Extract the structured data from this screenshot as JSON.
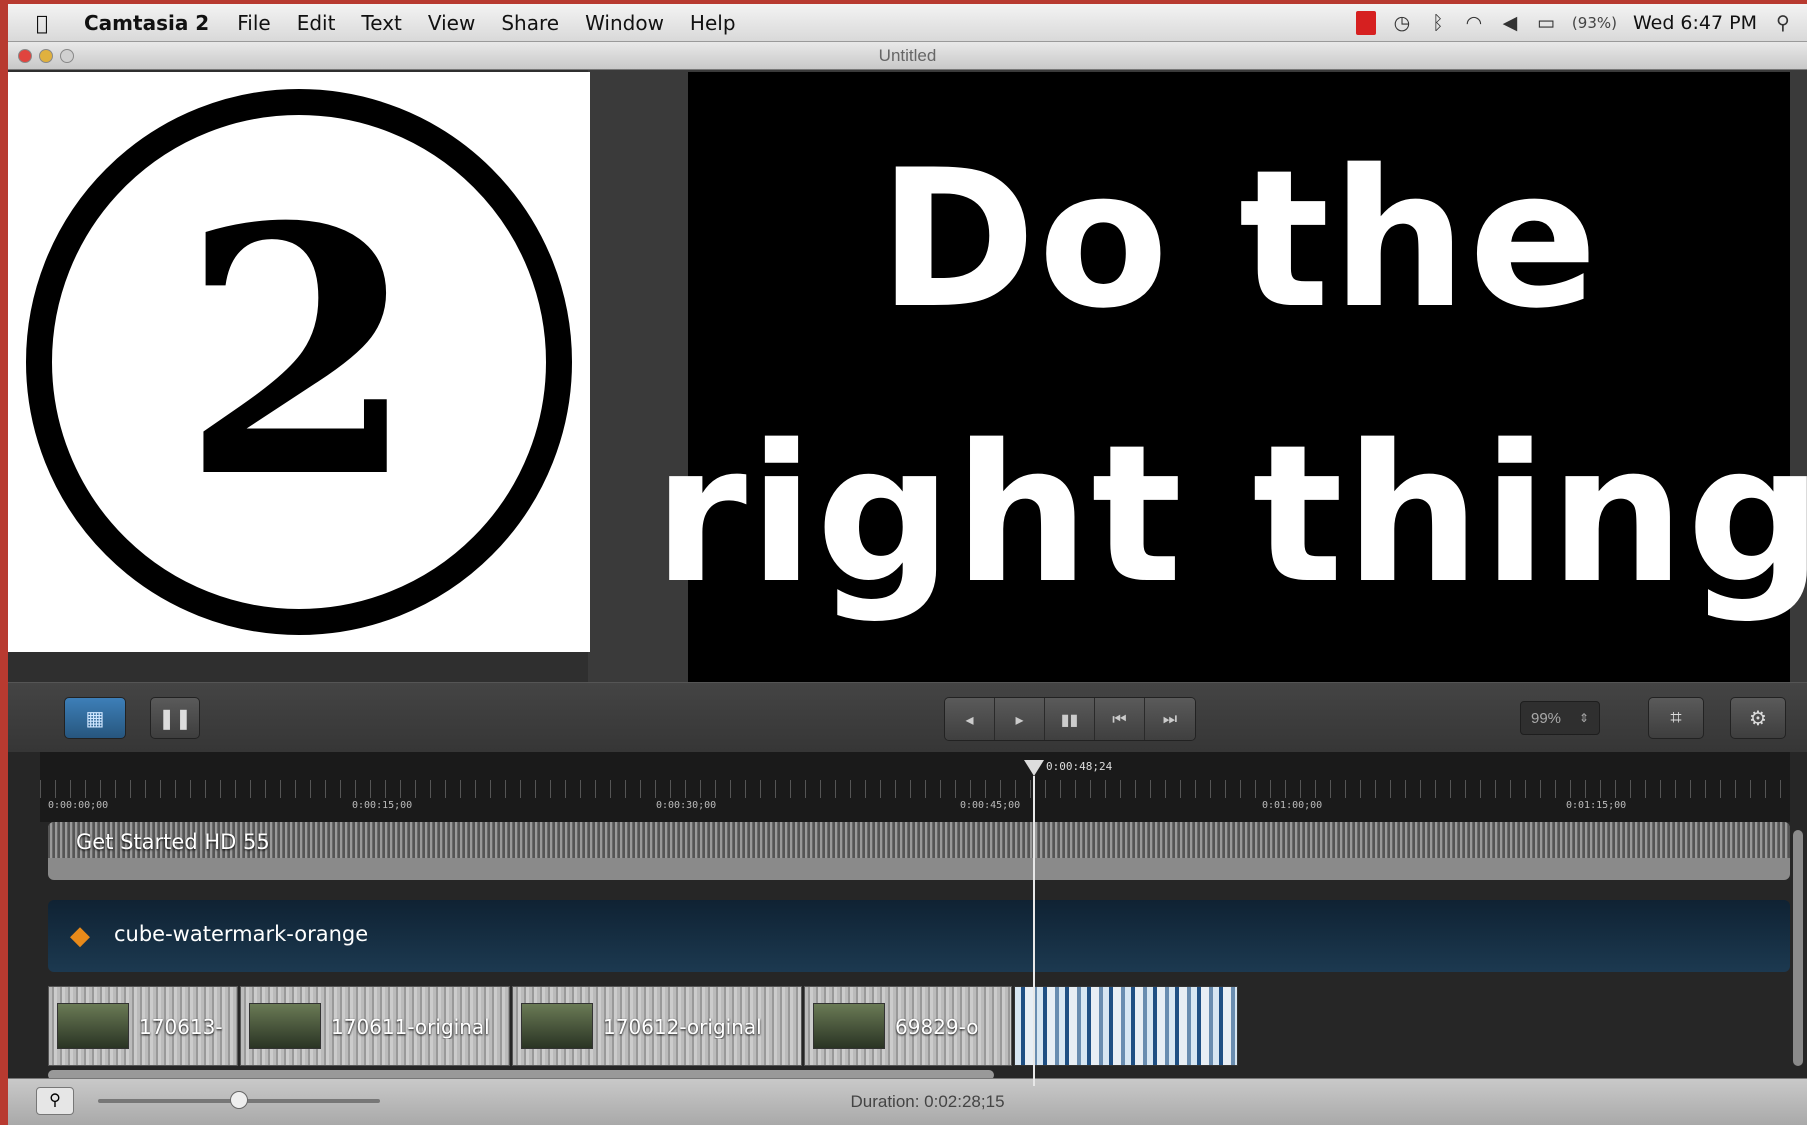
{
  "menubar": {
    "apple_icon": "",
    "app_name": "Camtasia 2",
    "items": [
      "File",
      "Edit",
      "Text",
      "View",
      "Share",
      "Window",
      "Help"
    ],
    "status": {
      "battery": "(93%)",
      "clock": "Wed 6:47 PM"
    }
  },
  "window": {
    "title": "Untitled"
  },
  "canvas": {
    "badge_number": "2",
    "slide_line_1": "Do the",
    "slide_line_2": "right thing"
  },
  "toolbar": {
    "zoom_value": "99%"
  },
  "timeline": {
    "playhead_time": "0:00:48;24",
    "ruler_labels": [
      "0:00:00;00",
      "0:00:15;00",
      "0:00:30;00",
      "0:00:45;00",
      "0:01:00;00",
      "0:01:15;00"
    ],
    "audio_clip": "Get Started HD 55",
    "watermark_clip": "cube-watermark-orange",
    "video_clips": [
      "170613-",
      "170611-original",
      "170612-original",
      "69829-o"
    ]
  },
  "bottombar": {
    "duration": "Duration: 0:02:28;15"
  },
  "colors": {
    "accent_blue": "#2f6a9f",
    "window_bg": "#3b3b3b",
    "watermark_orange": "#e88a1a"
  }
}
